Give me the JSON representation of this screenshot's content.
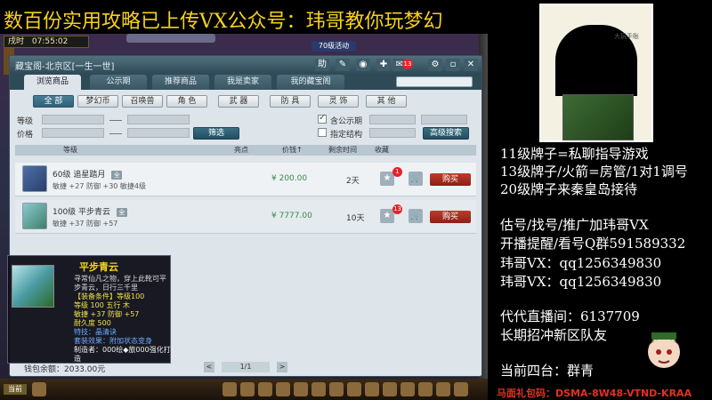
{
  "banner": {
    "text": "数百份实用攻略已上传VX公众号：玮哥教你玩梦幻"
  },
  "hud": {
    "time_label": "戌时",
    "time": "07:55:02",
    "event_tag": "70级活动"
  },
  "window": {
    "title": "藏宝阁-北京区[一生一世]",
    "help_btn": "助",
    "mail_badge": "13",
    "tabs": [
      {
        "label": "浏览商品"
      },
      {
        "label": "公示期"
      },
      {
        "label": "推荐商品"
      },
      {
        "label": "我是卖家"
      },
      {
        "label": "我的藏宝阁"
      }
    ],
    "categories": [
      "全 部",
      "梦幻币",
      "召唤兽",
      "角 色",
      "武 器",
      "防 具",
      "灵 饰",
      "其 他"
    ],
    "filters": {
      "level_label": "等级",
      "price_label": "价格",
      "filter_btn": "筛选",
      "include_notice": "含公示期",
      "designated_settle": "指定结构",
      "advanced_search": "高级搜索"
    },
    "columns": {
      "level": "等级",
      "attr": "亮点",
      "price": "价钱↑",
      "time_left": "剩余时间",
      "fav": "收藏"
    },
    "items": [
      {
        "name": "60级 追星踏月",
        "tag": "全",
        "stats": "敏捷 +27  防御 +30  敏捷4级",
        "price": "¥ 200.00",
        "time_left": "2天",
        "fav_count": "1",
        "buy_label": "购买"
      },
      {
        "name": "100级 平步青云",
        "tag": "全",
        "stats": "敏捷 +37  防御 +57",
        "price": "¥ 7777.00",
        "time_left": "10天",
        "fav_count": "13",
        "buy_label": "购买"
      }
    ],
    "wallet": "钱包余额：2033.00元",
    "pager": {
      "prev": "<",
      "text": "1/1",
      "next": ">"
    }
  },
  "tooltip": {
    "name": "平步青云",
    "lines": [
      {
        "cls": "tt-desc",
        "text": "寻常仙凡之物，穿上此靴可平"
      },
      {
        "cls": "tt-desc",
        "text": "步青云，日行三千里"
      },
      {
        "cls": "tt-yellow",
        "text": "【装备条件】等级100"
      },
      {
        "cls": "tt-yellow",
        "text": "等级 100   五行 木"
      },
      {
        "cls": "tt-yellow",
        "text": "敏捷 +37  防御 +57"
      },
      {
        "cls": "tt-yellow",
        "text": "耐久度 500"
      },
      {
        "cls": "tt-blue",
        "text": "特技：晶清诀"
      },
      {
        "cls": "tt-blue",
        "text": "套装效果：附加状态变身"
      },
      {
        "cls": "tt-white",
        "text": "制造者：000绘◆旅000强化打"
      },
      {
        "cls": "tt-white",
        "text": "造"
      }
    ]
  },
  "bottombar": {
    "chat_label": "当前"
  },
  "side": {
    "qr_caption": "大玩手账",
    "lines": [
      "11级牌子=私聊指导游戏",
      "13级牌子/火箭=房管/1对1调号",
      "20级牌子来秦皇岛接待",
      "估号/找号/推广加玮哥VX",
      "开播提醒/看号Q群591589332",
      "玮哥VX：qq1256349830",
      "玮哥VX：qq1256349830",
      "代代直播间：6137709",
      "长期招冲新区队友",
      "当前四台：群青"
    ],
    "gift_code": "马面礼包码：DSMA-8W48-VTND-KRAA"
  }
}
